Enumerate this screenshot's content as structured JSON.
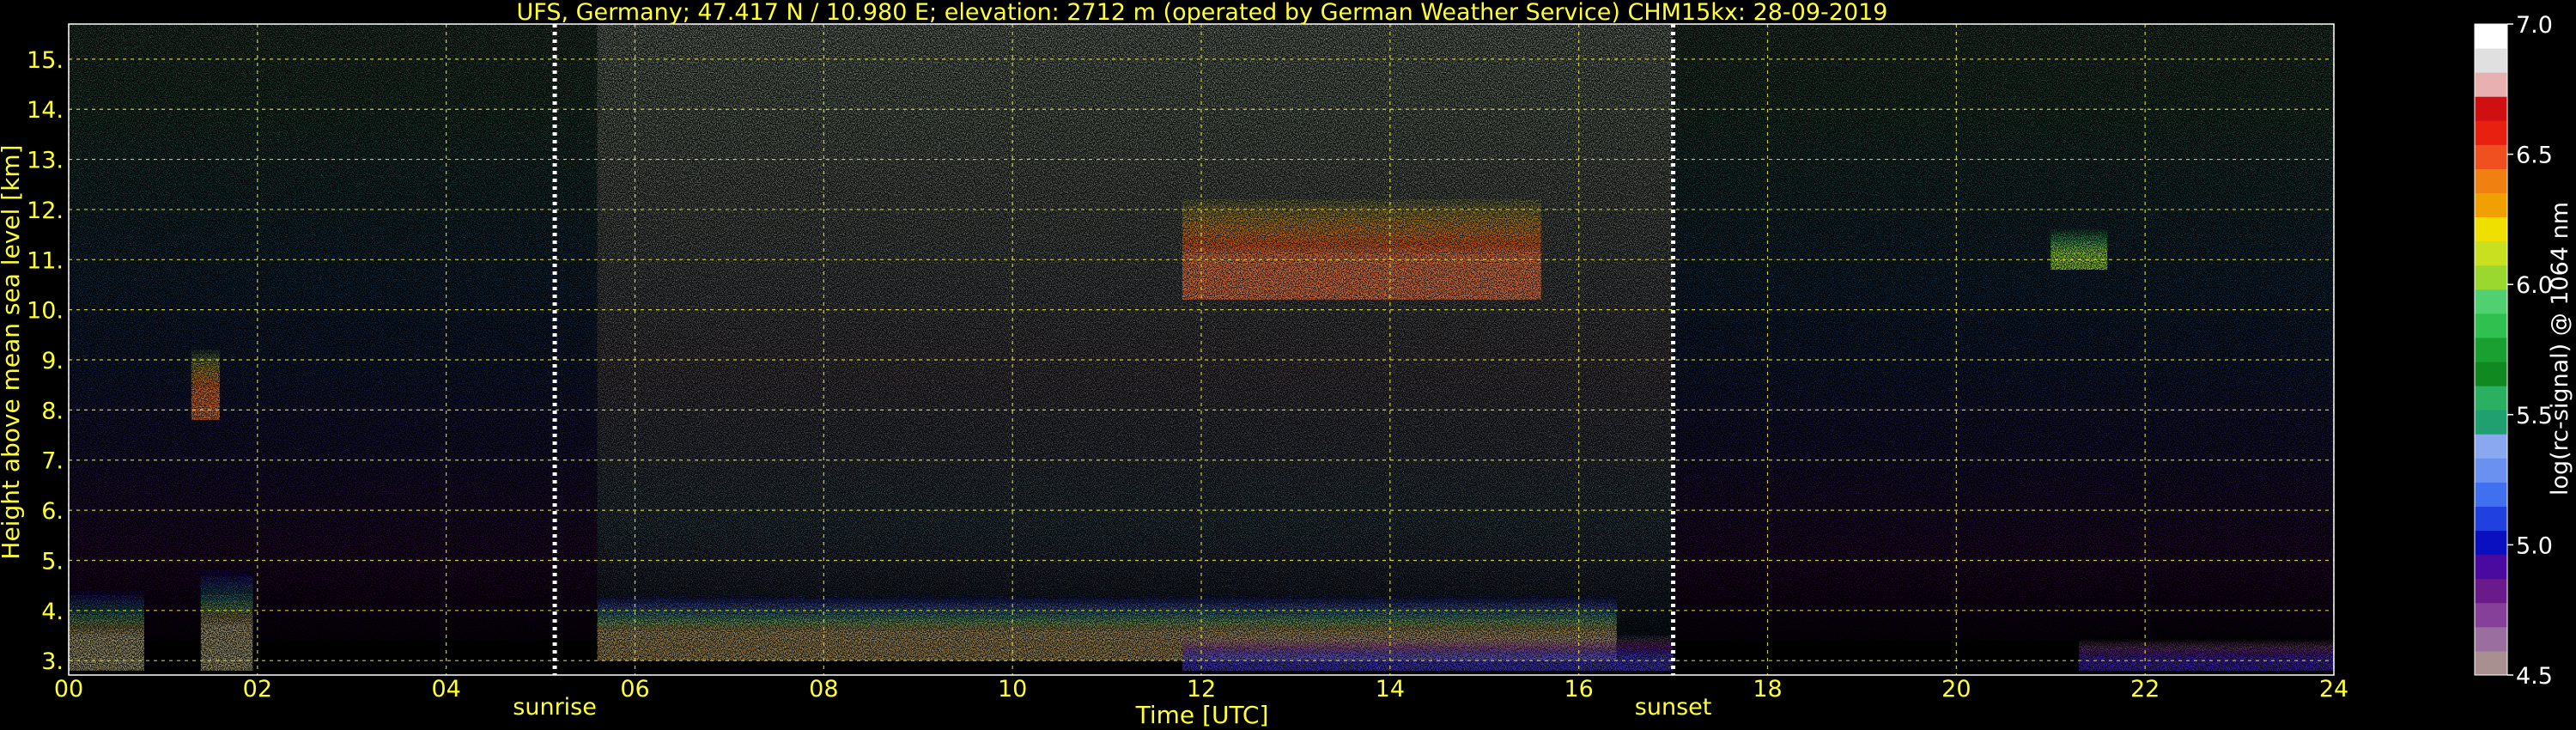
{
  "chart_data": {
    "type": "heatmap",
    "title": "UFS, Germany; 47.417 N / 10.980 E; elevation: 2712 m  (operated by German Weather Service)    CHM15kx: 28-09-2019",
    "xlabel": "Time [UTC]",
    "ylabel": "Height above mean sea level [km]",
    "xlim": [
      0,
      24
    ],
    "ylim": [
      2.712,
      15.7
    ],
    "x_ticks": [
      "00",
      "02",
      "04",
      "06",
      "08",
      "10",
      "12",
      "14",
      "16",
      "18",
      "20",
      "22",
      "24"
    ],
    "y_ticks": [
      "3.",
      "4.",
      "5.",
      "6.",
      "7.",
      "8.",
      "9.",
      "10.",
      "11.",
      "12.",
      "13.",
      "14.",
      "15."
    ],
    "grid": true,
    "annotations": [
      {
        "text": "sunrise",
        "x": 5.15
      },
      {
        "text": "sunset",
        "x": 17.0
      }
    ],
    "colorbar": {
      "label": "log(rc-signal) @ 1064 nm",
      "range": [
        4.5,
        7.0
      ],
      "ticks": [
        "4.5",
        "5.0",
        "5.5",
        "6.0",
        "6.5",
        "7.0"
      ],
      "colors": [
        "#a89090",
        "#9a6f9f",
        "#86409a",
        "#6a1a8a",
        "#4a0aa0",
        "#0a10c0",
        "#2040e0",
        "#4070f0",
        "#6a90f0",
        "#8aa8f0",
        "#20a070",
        "#2ab060",
        "#108a20",
        "#1aa030",
        "#30c050",
        "#50d070",
        "#9ad830",
        "#c8e020",
        "#f0e000",
        "#f0a000",
        "#f08010",
        "#f05020",
        "#e82010",
        "#d01010",
        "#e8b0b0",
        "#e0e0e0",
        "#ffffff"
      ]
    },
    "features": [
      {
        "name": "noise_daylight",
        "x": [
          5.6,
          17.0
        ],
        "y": [
          3.2,
          15.7
        ]
      },
      {
        "name": "boundary_layer_aerosol",
        "x": [
          5.6,
          16.4
        ],
        "y": [
          3.0,
          4.3
        ],
        "log_signal": [
          5.0,
          6.8
        ]
      },
      {
        "name": "boundary_layer_early",
        "x": [
          0.0,
          0.8
        ],
        "y": [
          2.8,
          4.4
        ],
        "log_signal": [
          5.0,
          7.0
        ]
      },
      {
        "name": "boundary_layer_early_2",
        "x": [
          1.4,
          1.95
        ],
        "y": [
          2.8,
          4.8
        ],
        "log_signal": [
          5.0,
          7.0
        ]
      },
      {
        "name": "cirrus_mid",
        "x": [
          11.8,
          15.6
        ],
        "y": [
          10.2,
          12.2
        ],
        "log_signal": [
          6.2,
          6.8
        ]
      },
      {
        "name": "cloud_early",
        "x": [
          1.3,
          1.6
        ],
        "y": [
          7.8,
          9.2
        ],
        "log_signal": [
          6.0,
          6.8
        ]
      },
      {
        "name": "cloud_late",
        "x": [
          21.0,
          21.6
        ],
        "y": [
          10.8,
          11.6
        ],
        "log_signal": [
          5.8,
          6.2
        ]
      },
      {
        "name": "residual_layer",
        "x": [
          11.8,
          17.0
        ],
        "y": [
          2.8,
          3.5
        ],
        "log_signal": [
          4.6,
          5.2
        ]
      },
      {
        "name": "night_layer",
        "x": [
          21.3,
          24.0
        ],
        "y": [
          2.8,
          3.4
        ],
        "log_signal": [
          4.6,
          5.1
        ]
      }
    ]
  }
}
